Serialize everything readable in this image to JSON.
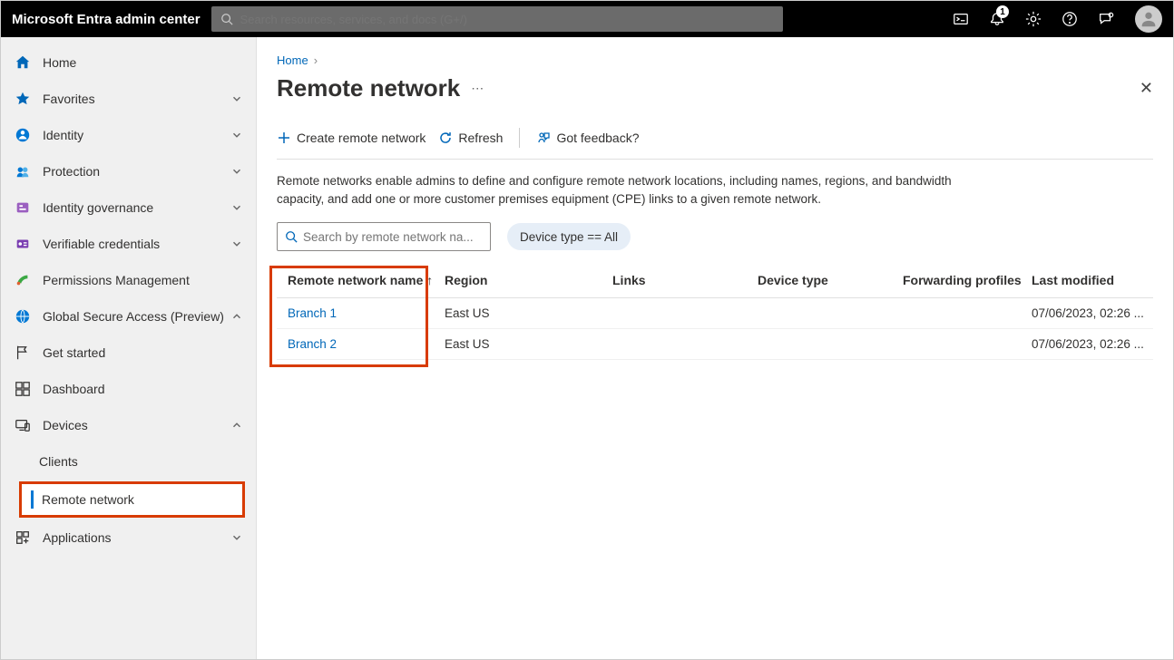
{
  "brand": "Microsoft Entra admin center",
  "search_placeholder": "Search resources, services, and docs (G+/)",
  "notification_count": "1",
  "sidebar": {
    "home": "Home",
    "favorites": "Favorites",
    "identity": "Identity",
    "protection": "Protection",
    "id_gov": "Identity governance",
    "ver_cred": "Verifiable credentials",
    "perms": "Permissions Management",
    "gsa": "Global Secure Access (Preview)",
    "get_started": "Get started",
    "dashboard": "Dashboard",
    "devices": "Devices",
    "clients": "Clients",
    "remote_network": "Remote network",
    "applications": "Applications"
  },
  "breadcrumb": {
    "home": "Home"
  },
  "page_title": "Remote network",
  "toolbar": {
    "create": "Create remote network",
    "refresh": "Refresh",
    "feedback": "Got feedback?"
  },
  "description": "Remote networks enable admins to define and configure remote network locations, including names, regions, and bandwidth capacity, and add one or more customer premises equipment (CPE) links to a given remote network.",
  "search_field_placeholder": "Search by remote network na...",
  "filter_pill": "Device type == All",
  "columns": {
    "name": "Remote network name",
    "region": "Region",
    "links": "Links",
    "device": "Device type",
    "forward": "Forwarding profiles",
    "modified": "Last modified"
  },
  "sort_arrow": "↑",
  "rows": [
    {
      "name": "Branch 1",
      "region": "East US",
      "links": "",
      "device": "",
      "forward": "",
      "modified": "07/06/2023, 02:26 ..."
    },
    {
      "name": "Branch 2",
      "region": "East US",
      "links": "",
      "device": "",
      "forward": "",
      "modified": "07/06/2023, 02:26 ..."
    }
  ]
}
